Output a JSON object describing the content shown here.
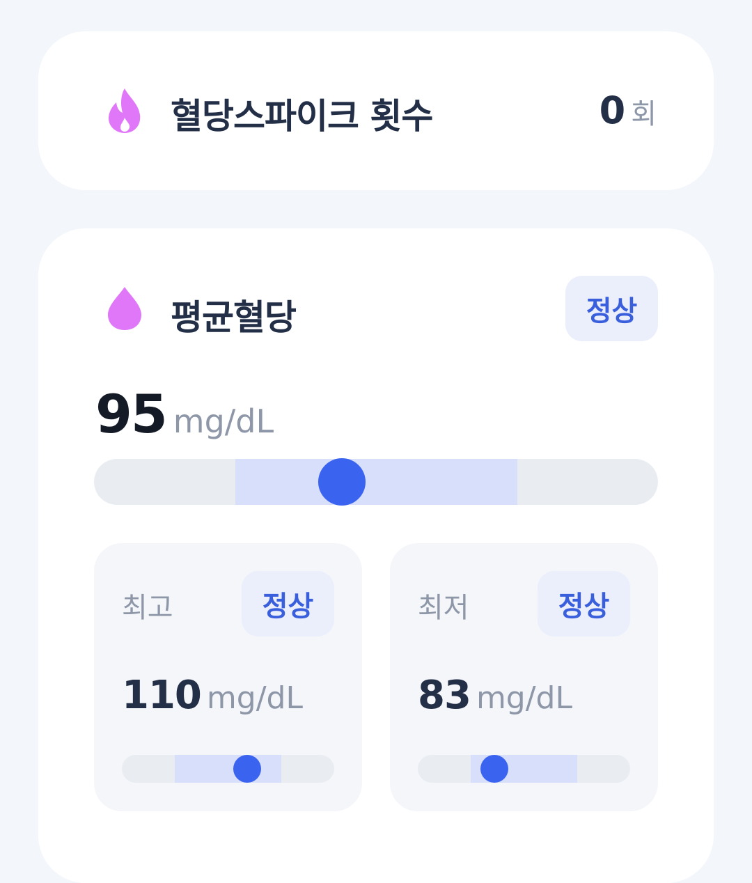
{
  "colors": {
    "background": "#f3f6fa",
    "card": "#ffffff",
    "icon": "#e076f8",
    "badge_bg": "#ebeffc",
    "badge_text": "#3a5fdc",
    "track": "#e9edf2",
    "range": "#d7dffa",
    "thumb": "#3a63f0"
  },
  "spike": {
    "icon": "fire-icon",
    "title": "혈당스파이크 횟수",
    "count": "0",
    "unit": "회"
  },
  "average": {
    "icon": "drop-icon",
    "title": "평균혈당",
    "status": "정상",
    "value": "95",
    "unit": "mg/dL",
    "gauge": {
      "range_start": 0.25,
      "range_end": 0.75,
      "position": 0.44
    }
  },
  "highest": {
    "label": "최고",
    "status": "정상",
    "value": "110",
    "unit": "mg/dL",
    "gauge": {
      "range_start": 0.25,
      "range_end": 0.75,
      "position": 0.59
    }
  },
  "lowest": {
    "label": "최저",
    "status": "정상",
    "value": "83",
    "unit": "mg/dL",
    "gauge": {
      "range_start": 0.25,
      "range_end": 0.75,
      "position": 0.36
    }
  }
}
